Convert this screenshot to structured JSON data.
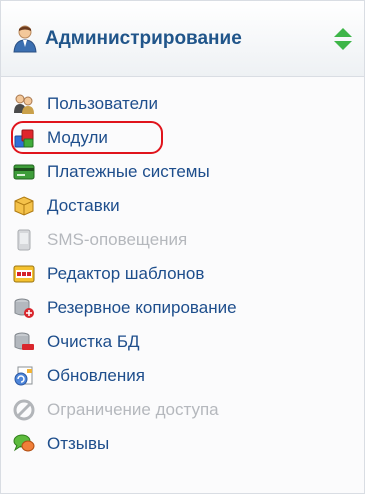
{
  "header": {
    "title": "Администрирование",
    "icon": "admin-user-icon",
    "toggle_icon": "expand-collapse-icon",
    "accent_color": "#20558a"
  },
  "menu": {
    "items": [
      {
        "label": "Пользователи",
        "icon": "users-icon",
        "enabled": true
      },
      {
        "label": "Модули",
        "icon": "modules-icon",
        "enabled": true,
        "highlighted": true
      },
      {
        "label": "Платежные системы",
        "icon": "payment-card-icon",
        "enabled": true
      },
      {
        "label": "Доставки",
        "icon": "delivery-box-icon",
        "enabled": true
      },
      {
        "label": "SMS-оповещения",
        "icon": "phone-icon",
        "enabled": false
      },
      {
        "label": "Редактор шаблонов",
        "icon": "css-icon",
        "enabled": true
      },
      {
        "label": "Резервное копирование",
        "icon": "database-backup-icon",
        "enabled": true
      },
      {
        "label": "Очистка БД",
        "icon": "database-clean-icon",
        "enabled": true
      },
      {
        "label": "Обновления",
        "icon": "updates-icon",
        "enabled": true
      },
      {
        "label": "Ограничение доступа",
        "icon": "access-restriction-icon",
        "enabled": false
      },
      {
        "label": "Отзывы",
        "icon": "reviews-icon",
        "enabled": true
      }
    ],
    "link_color": "#1e4e8c",
    "disabled_color": "#b5b8bd",
    "highlight_color": "#e0141c"
  }
}
